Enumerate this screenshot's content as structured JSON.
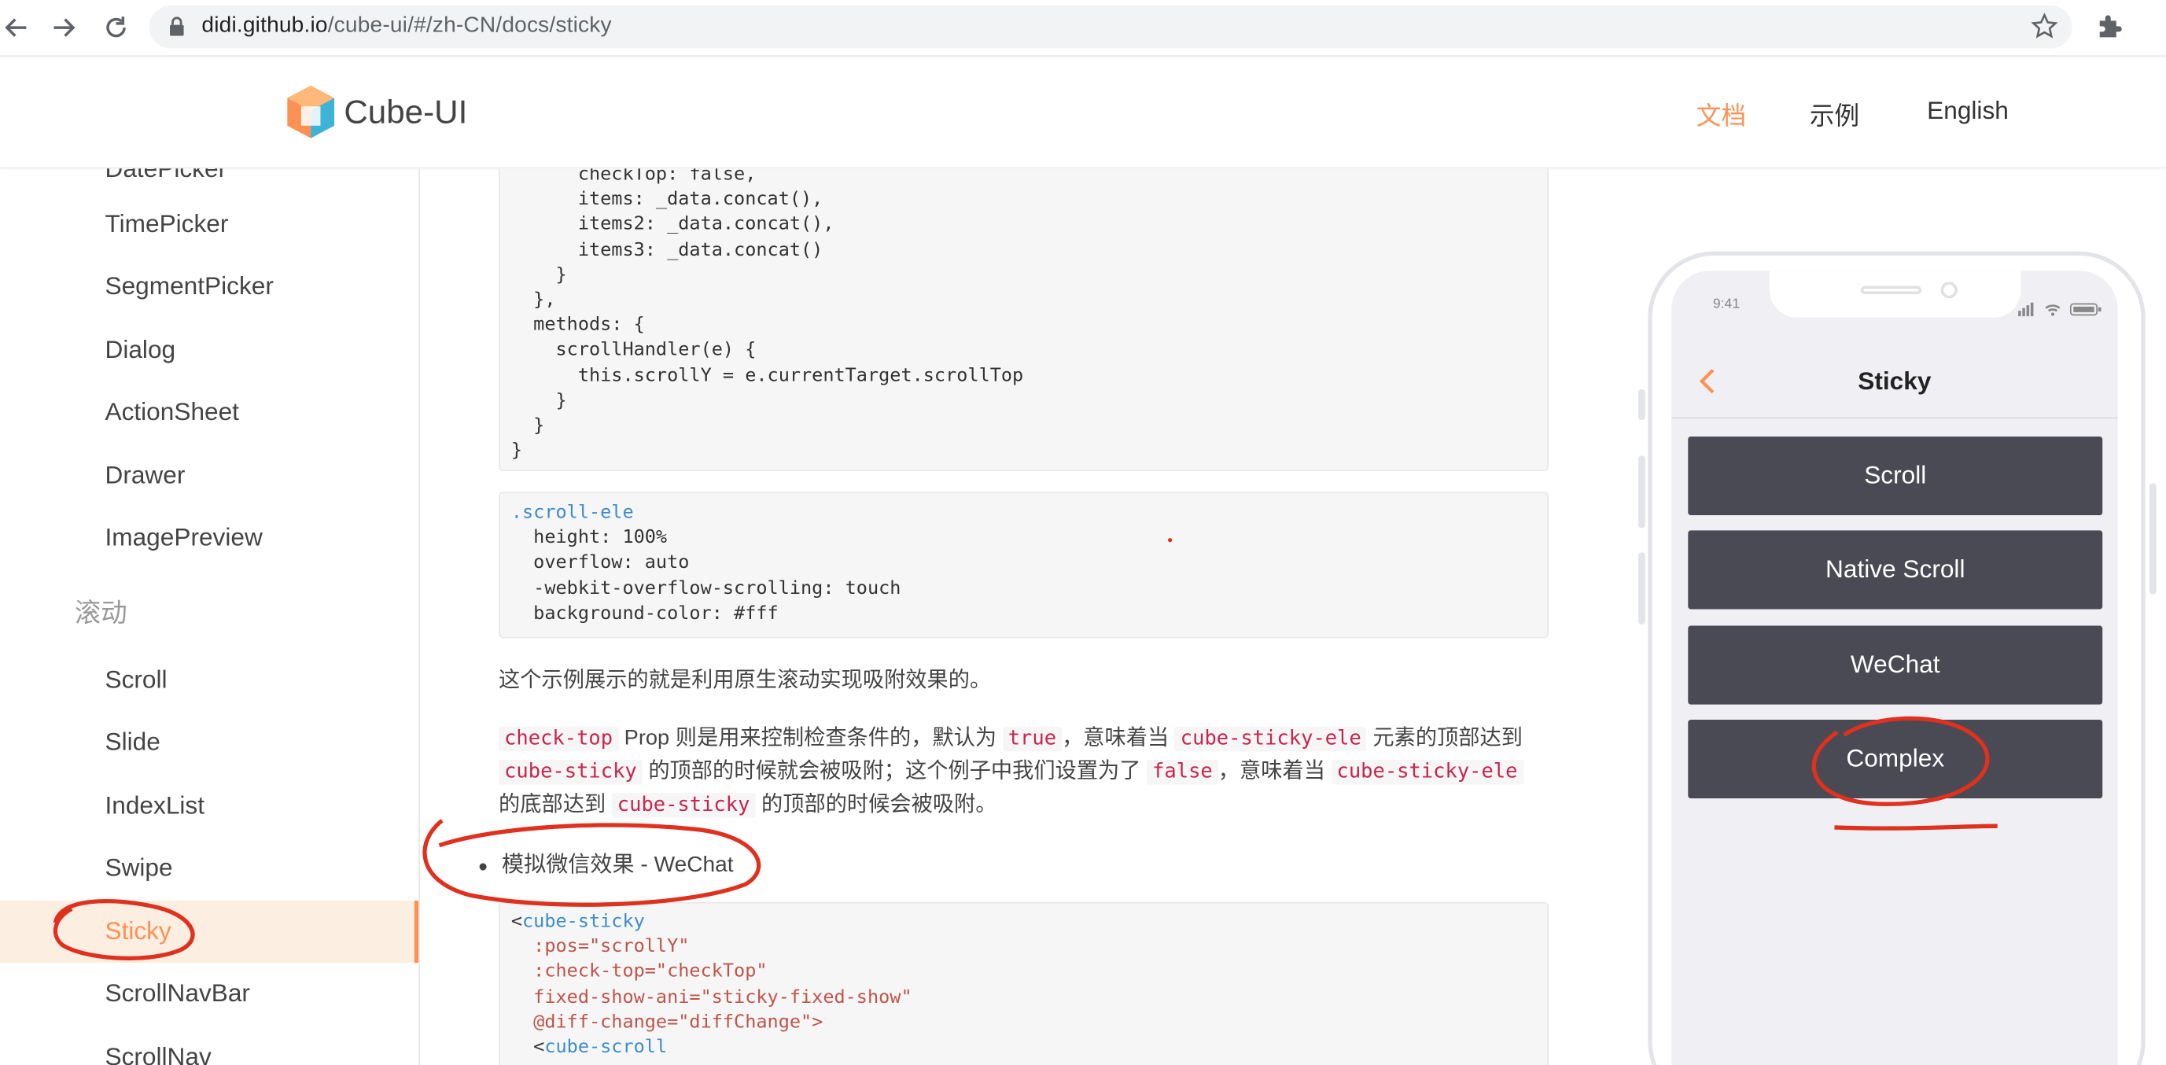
{
  "browser": {
    "url_host": "didi.github.io",
    "url_path": "/cube-ui/#/zh-CN/docs/sticky"
  },
  "header": {
    "brand": "Cube-UI",
    "nav": [
      {
        "label": "文档",
        "active": true
      },
      {
        "label": "示例",
        "active": false
      },
      {
        "label": "English",
        "active": false
      }
    ]
  },
  "sidebar": {
    "partial_top": "DatePicker",
    "items_a": [
      "TimePicker",
      "SegmentPicker",
      "Dialog",
      "ActionSheet",
      "Drawer",
      "ImagePreview"
    ],
    "group_scroll": "滚动",
    "items_b": [
      "Scroll",
      "Slide",
      "IndexList",
      "Swipe",
      "Sticky",
      "ScrollNavBar",
      "ScrollNav"
    ],
    "active": "Sticky"
  },
  "content": {
    "code1_lines": [
      "      checkTop: false,",
      "      items: _data.concat(),",
      "      items2: _data.concat(),",
      "      items3: _data.concat()",
      "    }",
      "  },",
      "  methods: {",
      "    scrollHandler(e) {",
      "      this.scrollY = e.currentTarget.scrollTop",
      "    }",
      "  }",
      "}"
    ],
    "code2_lines": [
      ".scroll-ele",
      "  height: 100%",
      "  overflow: auto",
      "  -webkit-overflow-scrolling: touch",
      "  background-color: #fff"
    ],
    "para1": "这个示例展示的就是利用原生滚动实现吸附效果的。",
    "para2": {
      "c1": "check-top",
      "t1": " Prop 则是用来控制检查条件的，默认为 ",
      "c2": "true",
      "t2": "，意味着当 ",
      "c3": "cube-sticky-ele",
      "t3": " 元素的顶部达到 ",
      "c4": "cube-sticky",
      "t4": " 的顶部的时候就会被吸附；这个例子中我们设置为了 ",
      "c5": "false",
      "t5": "，意味着当 ",
      "c6": "cube-sticky-ele",
      "t6": " 的底部达到 ",
      "c7": "cube-sticky",
      "t7": " 的顶部的时候会被吸附。"
    },
    "bullet": "模拟微信效果 - WeChat",
    "code3_lines": [
      "<cube-sticky",
      "  :pos=\"scrollY\"",
      "  :check-top=\"checkTop\"",
      "  fixed-show-ani=\"sticky-fixed-show\"",
      "  @diff-change=\"diffChange\">",
      "  <cube-scroll"
    ]
  },
  "phone": {
    "time": "9:41",
    "title": "Sticky",
    "buttons": [
      "Scroll",
      "Native Scroll",
      "WeChat",
      "Complex"
    ]
  },
  "colors": {
    "accent": "#fc9153",
    "annotation_red": "#e0301e",
    "phone_button": "#494a54"
  }
}
